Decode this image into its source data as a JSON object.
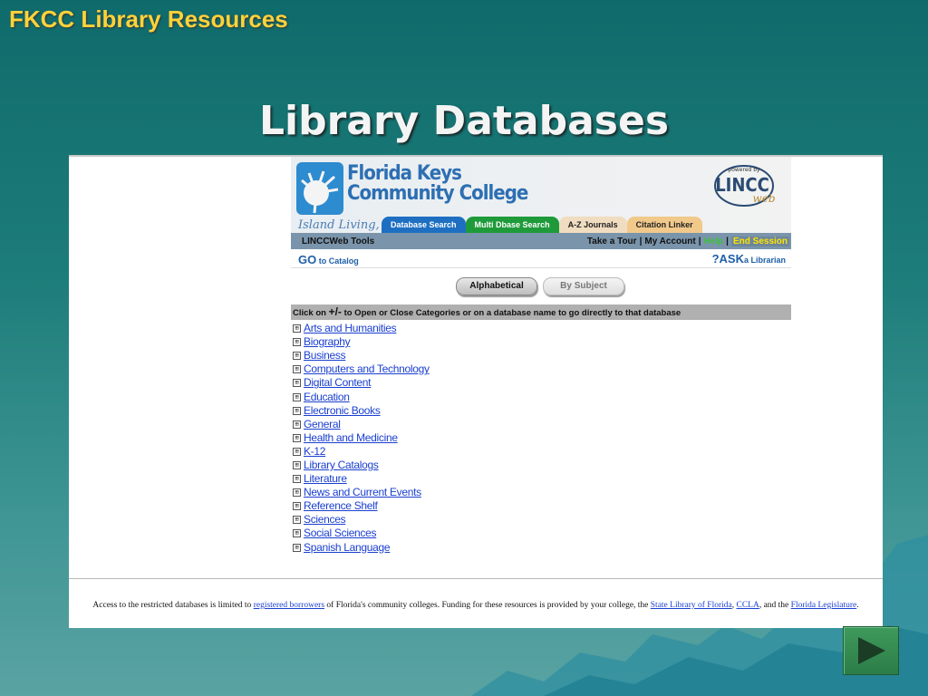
{
  "slide": {
    "header": "FKCC Library Resources",
    "title": "Library Databases"
  },
  "site": {
    "logo_line1": "Florida Keys",
    "logo_line2": "Community College",
    "tagline": "Island Living, I",
    "badge_top": "powered by",
    "badge_main": "LINCC",
    "badge_sub": "web",
    "tabs": [
      "Database Search",
      "Multi Dbase Search",
      "A-Z Journals",
      "Citation Linker"
    ],
    "toolbar": {
      "tools_label": "LINCCWeb Tools",
      "take_tour": "Take a Tour",
      "my_account": "My Account",
      "help": "Help",
      "end_session": "End Session",
      "separator": "|"
    },
    "go_catalog": {
      "go": "GO",
      "rest": " to Catalog"
    },
    "ask_librarian": {
      "ask": "?ASK",
      "rest": "a Librarian"
    },
    "mode_buttons": {
      "alphabetical": "Alphabetical",
      "by_subject": "By Subject"
    },
    "instructions": {
      "prefix": "Click on ",
      "symbol": "+/-",
      "suffix": " to Open or Close Categories or on a database name to go directly to that database"
    },
    "expand_symbol": "⊞",
    "categories": [
      "Arts and Humanities",
      "Biography",
      "Business",
      "Computers and Technology",
      "Digital Content",
      "Education",
      "Electronic Books",
      "General",
      "Health and Medicine",
      "K-12",
      "Library Catalogs",
      "Literature",
      "News and Current Events",
      "Reference Shelf",
      "Sciences",
      "Social Sciences",
      "Spanish Language"
    ]
  },
  "footer": {
    "t1": "Access to the restricted databases is limited to ",
    "l1": "registered borrowers",
    "t2": " of Florida's community colleges. Funding for these resources is provided by your college, the ",
    "l2": "State Library of Florida",
    "t3": ", ",
    "l3": "CCLA",
    "t4": ", and the ",
    "l4": "Florida Legislature",
    "t5": "."
  },
  "colors": {
    "header_yellow": "#ffd23a",
    "link_blue": "#1a3fd0",
    "tab_blue": "#1e6fc2",
    "tab_green": "#1f9a3a"
  }
}
